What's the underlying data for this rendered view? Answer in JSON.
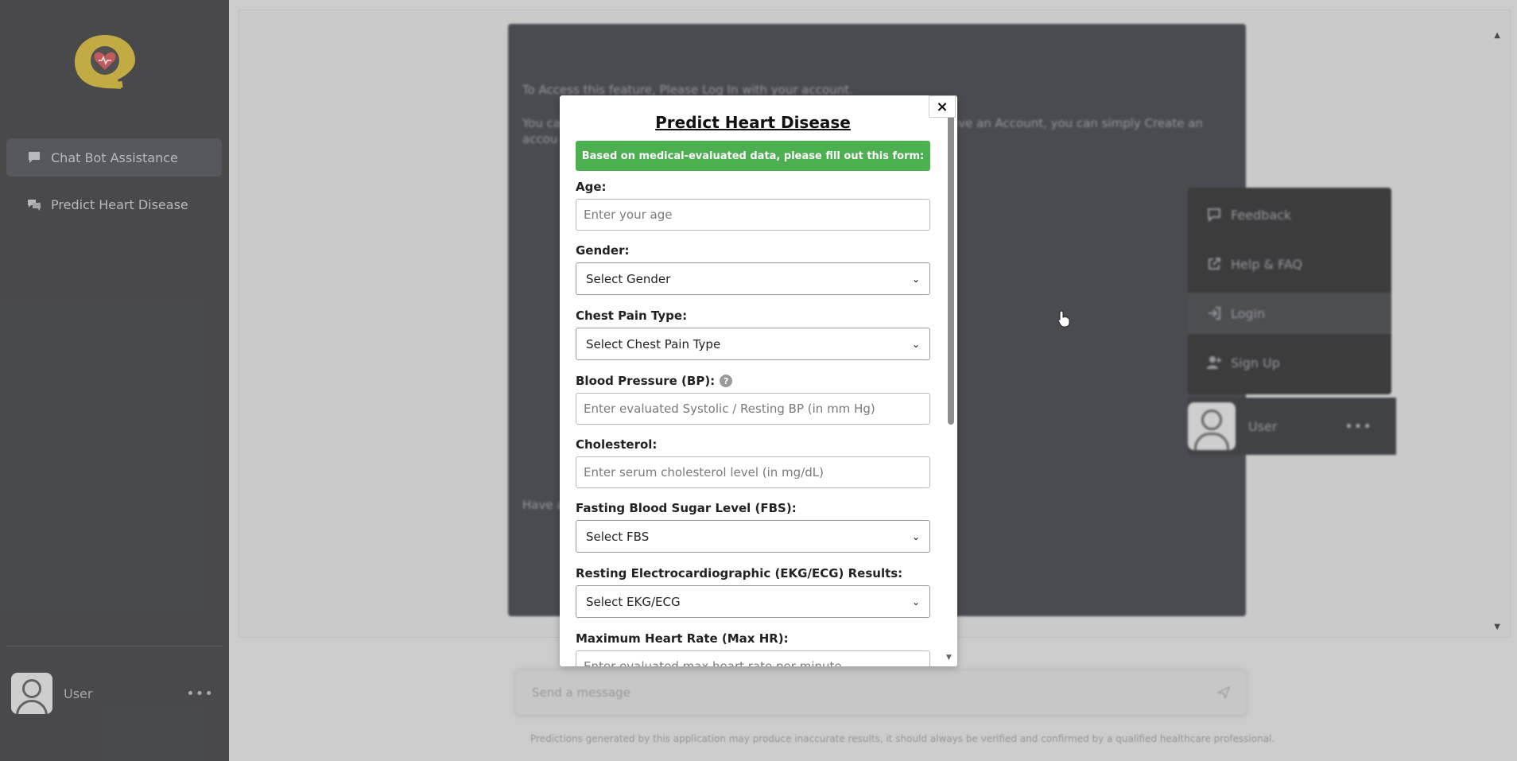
{
  "sidebar": {
    "items": [
      {
        "label": "Chat Bot Assistance",
        "icon": "chat-bubble-icon",
        "active": true
      },
      {
        "label": "Predict Heart Disease",
        "icon": "chat-bubbles-icon",
        "active": false
      }
    ],
    "user": {
      "name": "User",
      "more": "•••"
    }
  },
  "main": {
    "card": {
      "line1": "To Access this feature, Please Log In with your account.",
      "line2a": "You ca",
      "line2b": "ave an Account, you can simply Create an",
      "line3": "accou",
      "line4": "Have a"
    },
    "menu": {
      "items": [
        {
          "label": "Feedback",
          "icon": "feedback-icon"
        },
        {
          "label": "Help & FAQ",
          "icon": "external-link-icon"
        },
        {
          "label": "Login",
          "icon": "login-icon"
        },
        {
          "label": "Sign Up",
          "icon": "add-user-icon"
        }
      ],
      "user": {
        "name": "User",
        "more": "•••"
      }
    },
    "message_placeholder": "Send a message",
    "disclaimer": "Predictions generated by this application may produce inaccurate results, it should always be verified and confirmed by a qualified healthcare professional."
  },
  "modal": {
    "title": "Predict Heart Disease",
    "banner": "Based on medical-evaluated data, please fill out this form:",
    "close": "×",
    "fields": {
      "age": {
        "label": "Age:",
        "placeholder": "Enter your age"
      },
      "gender": {
        "label": "Gender:",
        "selected": "Select Gender"
      },
      "chest_pain": {
        "label": "Chest Pain Type:",
        "selected": "Select Chest Pain Type"
      },
      "bp": {
        "label": "Blood Pressure (BP):",
        "help": "?",
        "placeholder": "Enter evaluated Systolic / Resting BP (in mm Hg)"
      },
      "cholesterol": {
        "label": "Cholesterol:",
        "placeholder": "Enter serum cholesterol level (in mg/dL)"
      },
      "fbs": {
        "label": "Fasting Blood Sugar Level (FBS):",
        "selected": "Select FBS"
      },
      "ekg": {
        "label": "Resting Electrocardiographic (EKG/ECG) Results:",
        "selected": "Select EKG/ECG"
      },
      "max_hr": {
        "label": "Maximum Heart Rate (Max HR):",
        "placeholder": "Enter evaluated max heart rate per minute"
      }
    }
  },
  "colors": {
    "sidebar_bg": "#202123",
    "banner_green": "#4caf50",
    "logo_yellow": "#c9a81a",
    "logo_red": "#c43a3a"
  }
}
